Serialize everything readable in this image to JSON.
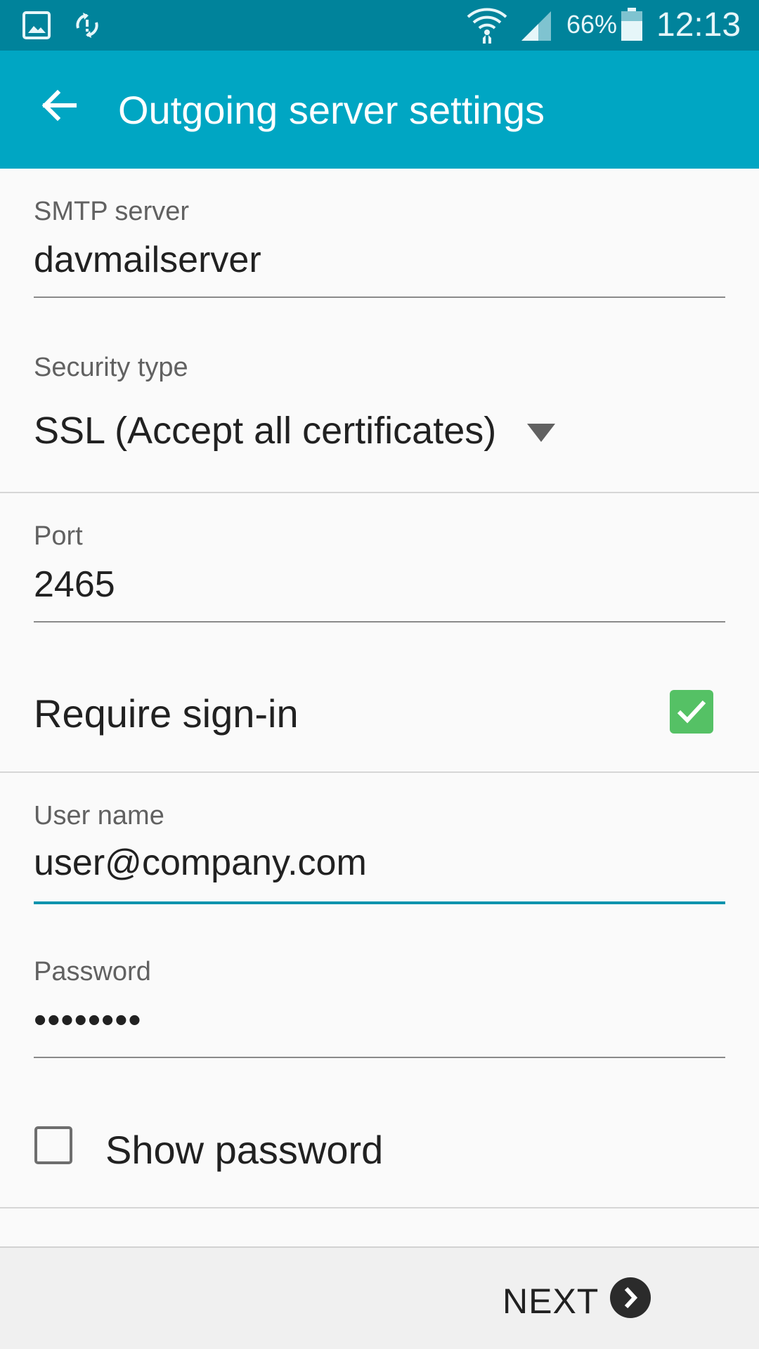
{
  "status_bar": {
    "battery": "66%",
    "time": "12:13",
    "icons": [
      "gallery-notification-icon",
      "sync-icon",
      "wifi-icon",
      "signal-icon",
      "battery-icon"
    ]
  },
  "app_bar": {
    "title": "Outgoing server settings",
    "back_icon": "arrow-back-icon"
  },
  "form": {
    "smtp_server": {
      "label": "SMTP server",
      "value": "davmailserver"
    },
    "security_type": {
      "label": "Security type",
      "value": "SSL (Accept all certificates)"
    },
    "port": {
      "label": "Port",
      "value": "2465"
    },
    "require_signin": {
      "label": "Require sign-in",
      "checked": true
    },
    "username": {
      "label": "User name",
      "value": "user@company.com",
      "focused": true
    },
    "password": {
      "label": "Password",
      "value": "••••••••"
    },
    "show_password": {
      "label": "Show password",
      "checked": false
    }
  },
  "footer": {
    "next_label": "NEXT"
  },
  "colors": {
    "status_bar": "#00839b",
    "app_bar": "#00a6c3",
    "accent": "#0a93ad",
    "checkbox_checked": "#55c165",
    "background": "#fafafa"
  }
}
